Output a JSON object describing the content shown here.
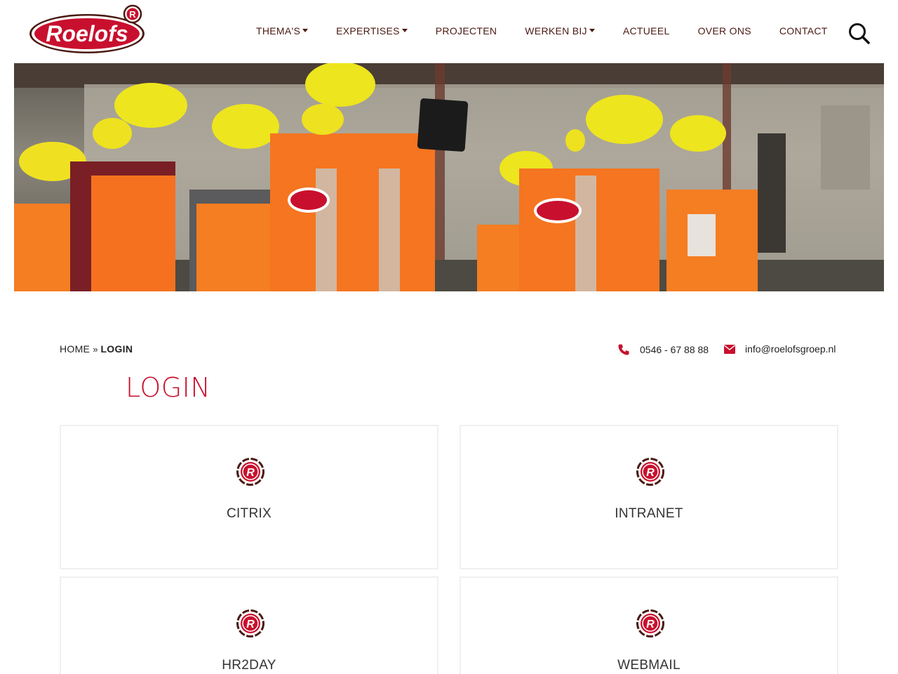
{
  "brand": {
    "logo_text": "Roelofs",
    "primary_color": "#c8102e",
    "dark_color": "#4a1a12"
  },
  "nav": {
    "items": [
      {
        "label": "THEMA'S",
        "dropdown": true
      },
      {
        "label": "EXPERTISES",
        "dropdown": true
      },
      {
        "label": "PROJECTEN",
        "dropdown": false
      },
      {
        "label": "WERKEN BIJ",
        "dropdown": true
      },
      {
        "label": "ACTUEEL",
        "dropdown": false
      },
      {
        "label": "OVER ONS",
        "dropdown": false
      },
      {
        "label": "CONTACT",
        "dropdown": false
      }
    ],
    "search_icon": "search-icon"
  },
  "breadcrumb": {
    "home": "HOME",
    "separator": "»",
    "current": "LOGIN"
  },
  "contact": {
    "phone": "0546 - 67 88 88",
    "email": "info@roelofsgroep.nl"
  },
  "page": {
    "title": "LOGIN"
  },
  "cards": [
    {
      "label": "CITRIX",
      "icon": "roelofs-r-icon"
    },
    {
      "label": "INTRANET",
      "icon": "roelofs-r-icon"
    },
    {
      "label": "HR2DAY",
      "icon": "roelofs-r-icon"
    },
    {
      "label": "WEBMAIL",
      "icon": "roelofs-r-icon"
    }
  ]
}
